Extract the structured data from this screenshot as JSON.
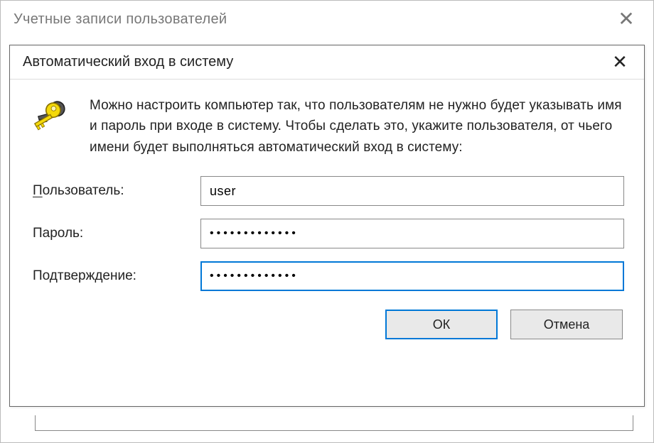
{
  "parent": {
    "title": "Учетные записи пользователей",
    "close_glyph": "✕"
  },
  "dialog": {
    "title": "Автоматический вход в систему",
    "close_glyph": "✕",
    "intro": "Можно настроить компьютер так, что пользователям не нужно будет указывать имя и пароль при входе в систему. Чтобы сделать это, укажите пользователя, от чьего имени будет выполняться автоматический вход в систему:",
    "user_label_pre": "П",
    "user_label_rest": "ользователь:",
    "user_value": "user",
    "password_label": "Пароль:",
    "password_value": "•••••••••••••",
    "confirm_label": "Подтверждение:",
    "confirm_value": "•••••••••••••",
    "ok_label": "ОК",
    "cancel_label": "Отмена"
  }
}
